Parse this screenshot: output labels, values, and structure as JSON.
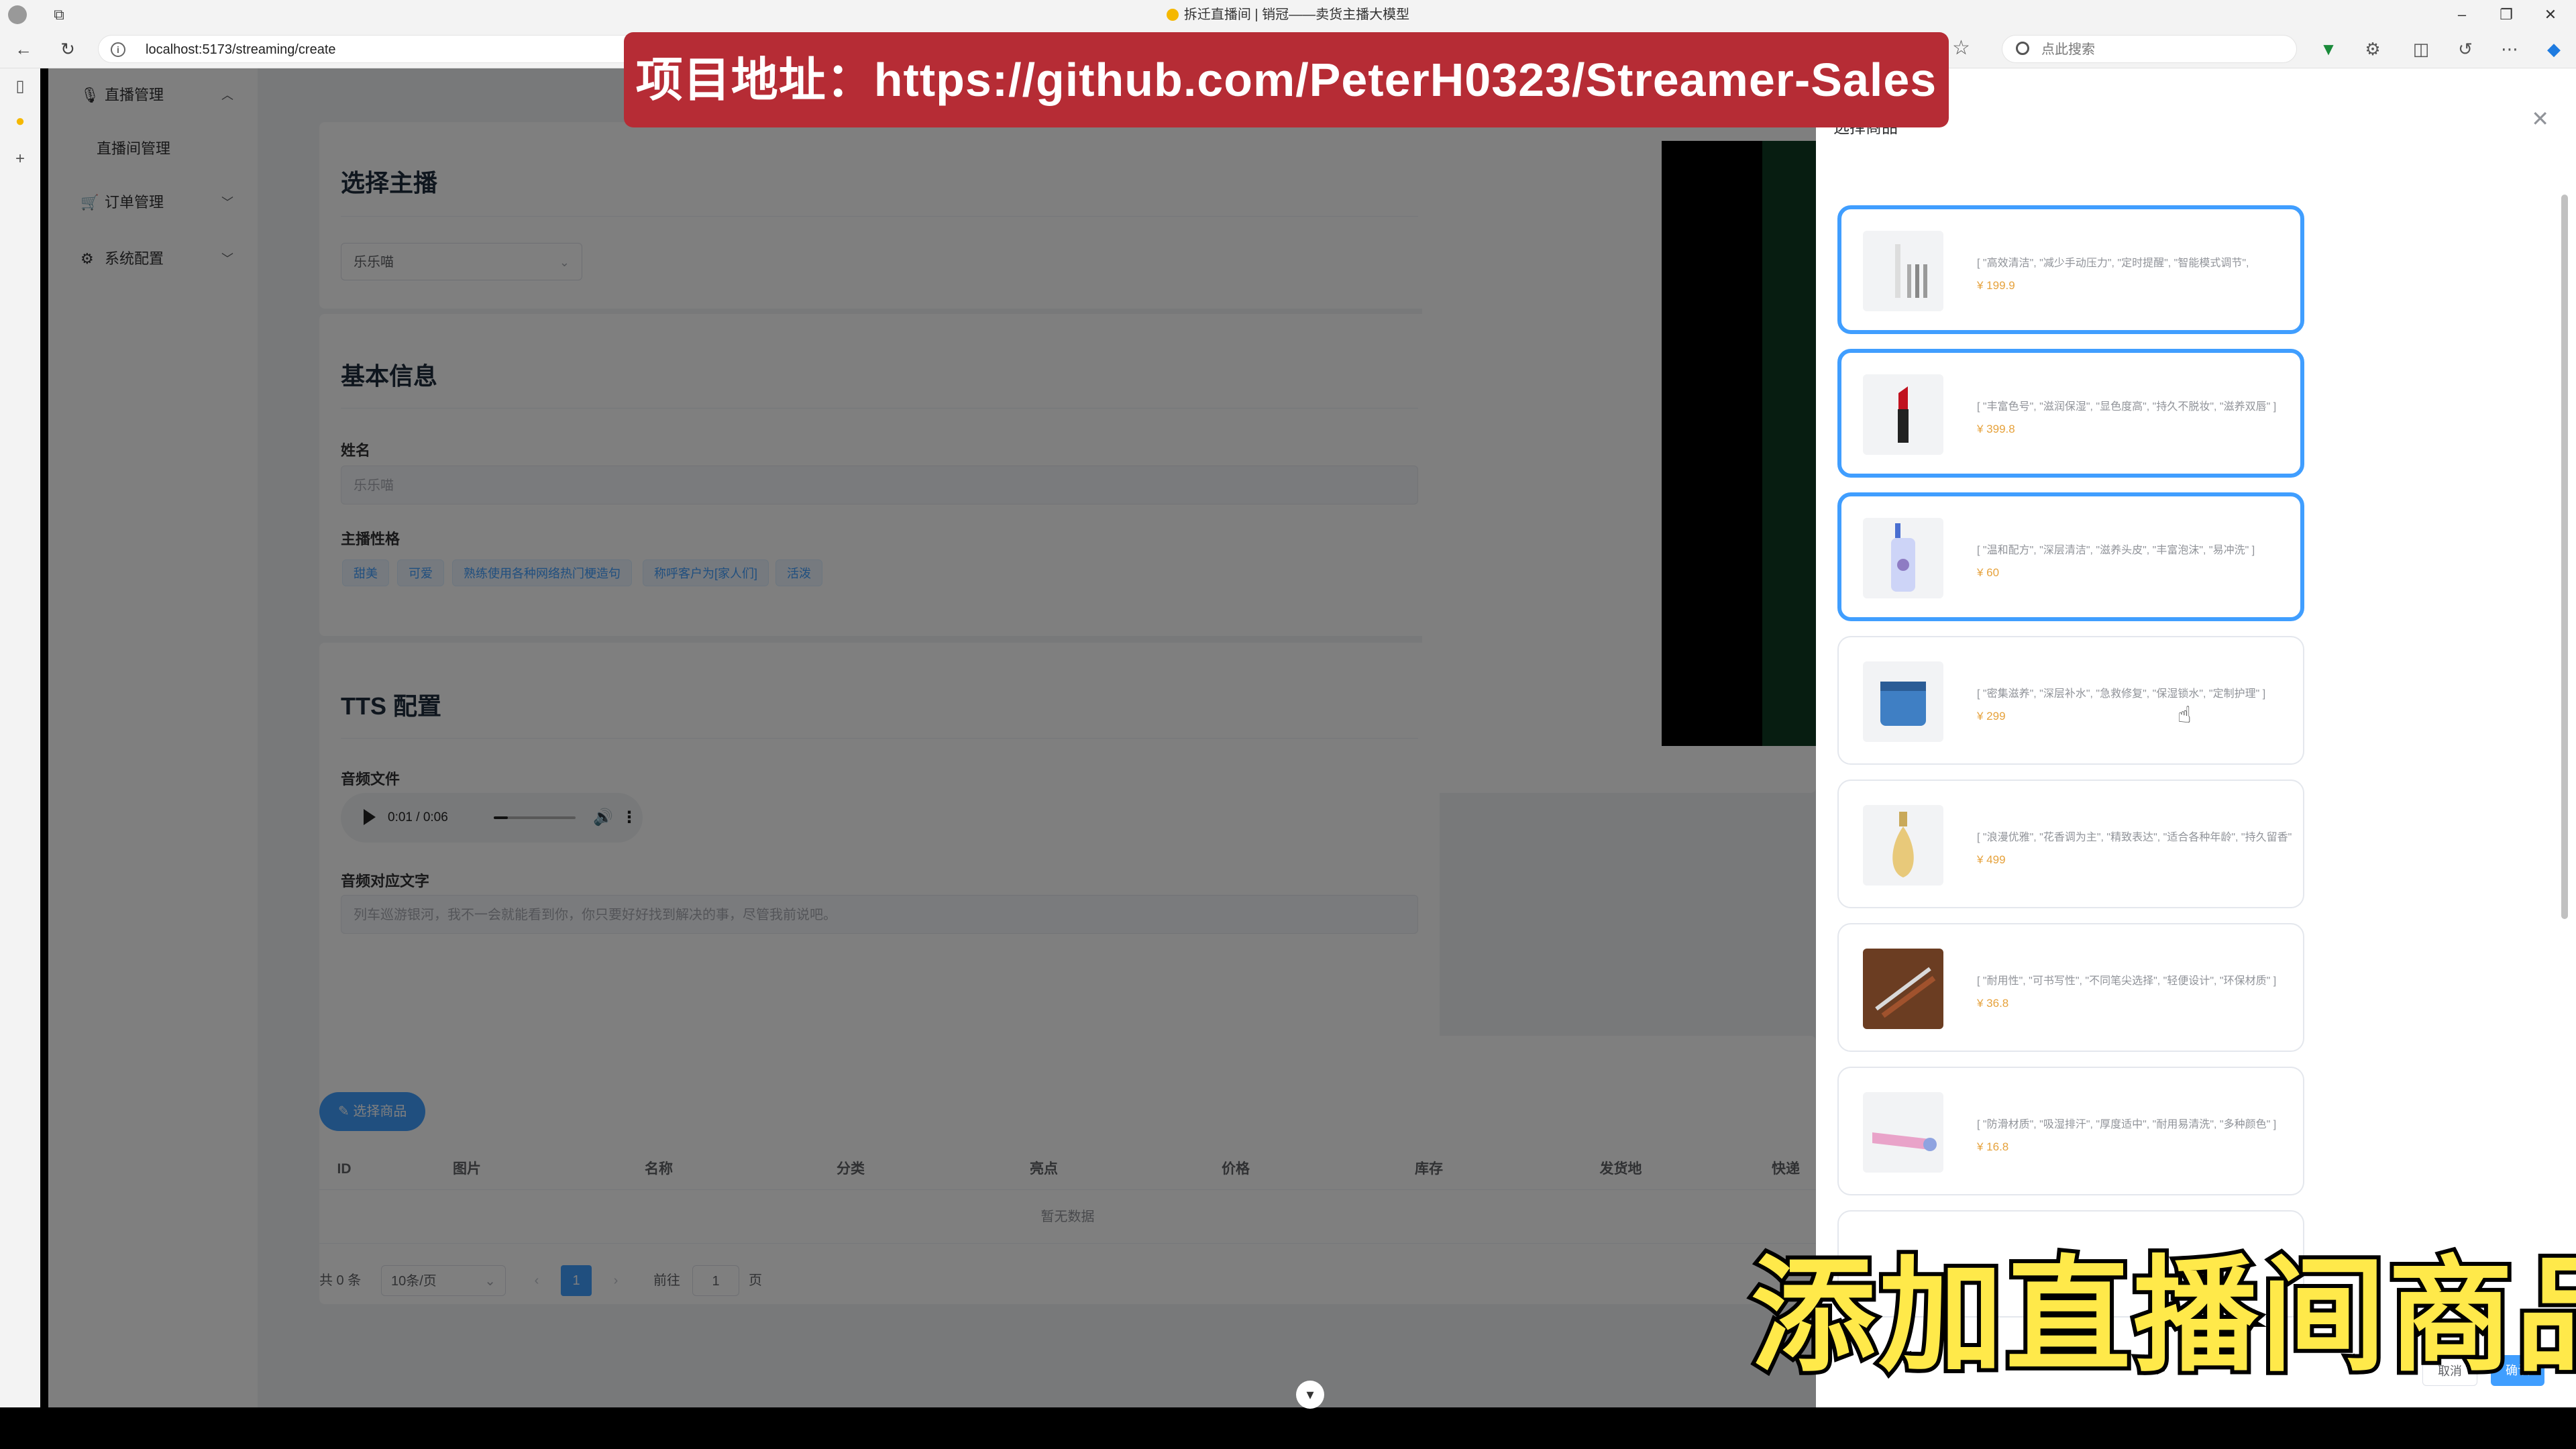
{
  "browser": {
    "window_title": "拆迁直播间 | 销冠——卖货主播大模型",
    "url": "localhost:5173/streaming/create",
    "search_placeholder": "点此搜索"
  },
  "sidebar": {
    "items": [
      {
        "label": "直播管理",
        "arrow": "︿"
      },
      {
        "label": "直播间管理",
        "arrow": ""
      },
      {
        "label": "订单管理",
        "arrow": "﹀"
      },
      {
        "label": "系统配置",
        "arrow": "﹀"
      }
    ]
  },
  "streamer_section": {
    "title": "选择主播",
    "selected": "乐乐喵"
  },
  "basic_info": {
    "title": "基本信息",
    "name_label": "姓名",
    "name_value": "乐乐喵",
    "character_label": "主播性格",
    "tags": [
      "甜美",
      "可爱",
      "熟练使用各种网络热门梗造句",
      "称呼客户为[家人们]",
      "活泼"
    ]
  },
  "tts": {
    "title": "TTS 配置",
    "audio_label": "音频文件",
    "audio_time": "0:01 / 0:06",
    "audio_progress": 0.17,
    "text_label": "音频对应文字",
    "text_value": "列车巡游银河，我不一会就能看到你，你只要好好找到解决的事，尽管我前说吧。"
  },
  "products_table": {
    "select_button": "选择商品",
    "columns": [
      "ID",
      "图片",
      "名称",
      "分类",
      "亮点",
      "价格",
      "库存",
      "发货地",
      "快递"
    ],
    "empty_text": "暂无数据",
    "pagination": {
      "total": "共 0 条",
      "page_size": "10条/页",
      "prev": "‹",
      "current_page": "1",
      "next": "›",
      "goto_label": "前往",
      "goto_value": "1",
      "goto_unit": "页"
    }
  },
  "drawer": {
    "title": "选择商品",
    "cancel": "取消",
    "confirm": "确认",
    "products": [
      {
        "desc": "[ \"高效清洁\", \"减少手动压力\", \"定时提醒\", \"智能模式调节\", ",
        "price": "¥ 199.9",
        "selected": true,
        "icon": "toothbrush-icon"
      },
      {
        "desc": "[ \"丰富色号\", \"滋润保湿\", \"显色度高\", \"持久不脱妆\", \"滋养双唇\" ]",
        "price": "¥ 399.8",
        "selected": true,
        "icon": "lipstick-icon"
      },
      {
        "desc": "[ \"温和配方\", \"深层清洁\", \"滋养头皮\", \"丰富泡沫\", \"易冲洗\" ]",
        "price": "¥ 60",
        "selected": true,
        "icon": "shampoo-icon"
      },
      {
        "desc": "[ \"密集滋养\", \"深层补水\", \"急救修复\", \"保湿锁水\", \"定制护理\" ]",
        "price": "¥ 299",
        "selected": false,
        "icon": "cream-jar-icon"
      },
      {
        "desc": "[ \"浪漫优雅\", \"花香调为主\", \"精致表达\", \"适合各种年龄\", \"持久留香\" ]",
        "price": "¥ 499",
        "selected": false,
        "icon": "perfume-icon"
      },
      {
        "desc": "[ \"耐用性\", \"可书写性\", \"不同笔尖选择\", \"轻便设计\", \"环保材质\" ]",
        "price": "¥ 36.8",
        "selected": false,
        "icon": "pen-icon"
      },
      {
        "desc": "[ \"防滑材质\", \"吸湿排汗\", \"厚度适中\", \"耐用易清洗\", \"多种颜色\" ]",
        "price": "¥ 16.8",
        "selected": false,
        "icon": "yoga-mat-icon"
      }
    ]
  },
  "overlay": {
    "banner": "项目地址：https://github.com/PeterH0323/Streamer-Sales",
    "subtitle": "添加直播间商品"
  },
  "colors": {
    "primary": "#409eff",
    "banner_bg": "#b62c35",
    "subtitle": "#ffe94a",
    "price": "#e6a23c"
  }
}
